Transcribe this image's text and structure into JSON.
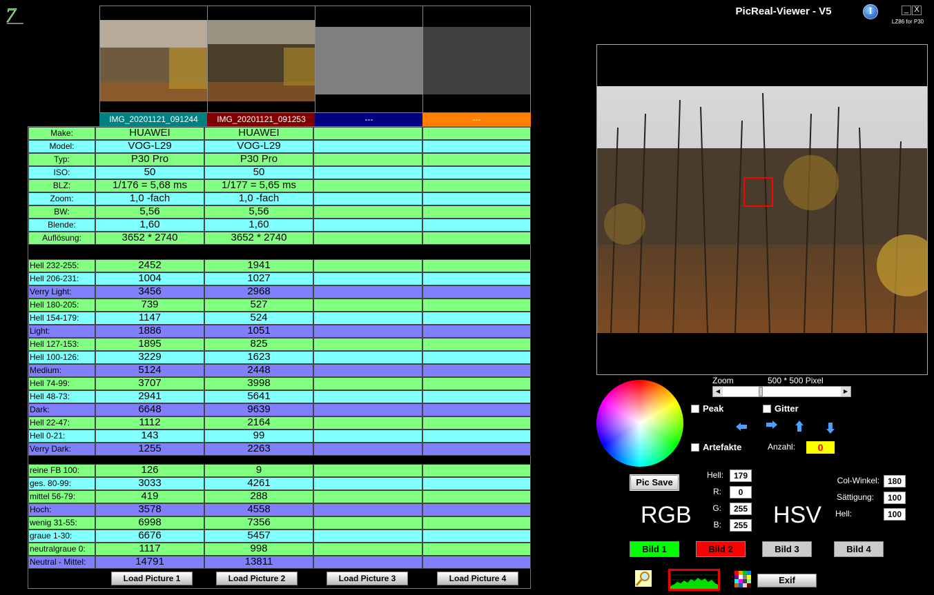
{
  "app": {
    "title": "PicReal-Viewer - V5",
    "subtitle": "LZ86 for P30",
    "min_label": "_",
    "close_label": "X",
    "info_label": "I"
  },
  "files": [
    {
      "name": "IMG_20201121_091244",
      "color": "#008080"
    },
    {
      "name": "IMG_20201121_091253",
      "color": "#800000"
    },
    {
      "name": "---",
      "color": "#000080"
    },
    {
      "name": "---",
      "color": "#ff8000"
    }
  ],
  "exif_rows": [
    {
      "label": "Make:",
      "values": [
        "HUAWEI",
        "HUAWEI",
        "",
        ""
      ],
      "color": "#80ff80"
    },
    {
      "label": "Model:",
      "values": [
        "VOG-L29",
        "VOG-L29",
        "",
        ""
      ],
      "color": "#80ffff"
    },
    {
      "label": "Typ:",
      "values": [
        "P30 Pro",
        "P30 Pro",
        "",
        ""
      ],
      "color": "#80ff80"
    },
    {
      "label": "ISO:",
      "values": [
        "50",
        "50",
        "",
        ""
      ],
      "color": "#80ffff"
    },
    {
      "label": "BLZ:",
      "values": [
        "1/176 = 5,68 ms",
        "1/177 = 5,65 ms",
        "",
        ""
      ],
      "color": "#80ff80"
    },
    {
      "label": "Zoom:",
      "values": [
        "1,0 -fach",
        "1,0 -fach",
        "",
        ""
      ],
      "color": "#80ffff"
    },
    {
      "label": "BW:",
      "values": [
        "5,56",
        "5,56",
        "",
        ""
      ],
      "color": "#80ff80"
    },
    {
      "label": "Blende:",
      "values": [
        "1,60",
        "1,60",
        "",
        ""
      ],
      "color": "#80ffff"
    },
    {
      "label": "Auflösung:",
      "values": [
        "3652 * 2740",
        "3652 * 2740",
        "",
        ""
      ],
      "color": "#80ff80"
    }
  ],
  "bright_rows": [
    {
      "label": "Hell 232-255:",
      "values": [
        "2452",
        "1941",
        "",
        ""
      ],
      "color": "#80ff80"
    },
    {
      "label": "Hell 206-231:",
      "values": [
        "1004",
        "1027",
        "",
        ""
      ],
      "color": "#80ffff"
    },
    {
      "label": "Verry Light:",
      "values": [
        "3456",
        "2968",
        "",
        ""
      ],
      "color": "#8080ff"
    },
    {
      "label": "Hell 180-205:",
      "values": [
        "739",
        "527",
        "",
        ""
      ],
      "color": "#80ff80"
    },
    {
      "label": "Hell 154-179:",
      "values": [
        "1147",
        "524",
        "",
        ""
      ],
      "color": "#80ffff"
    },
    {
      "label": "Light:",
      "values": [
        "1886",
        "1051",
        "",
        ""
      ],
      "color": "#8080ff"
    },
    {
      "label": "Hell 127-153:",
      "values": [
        "1895",
        "825",
        "",
        ""
      ],
      "color": "#80ff80"
    },
    {
      "label": "Hell 100-126:",
      "values": [
        "3229",
        "1623",
        "",
        ""
      ],
      "color": "#80ffff"
    },
    {
      "label": "Medium:",
      "values": [
        "5124",
        "2448",
        "",
        ""
      ],
      "color": "#8080ff"
    },
    {
      "label": "Hell 74-99:",
      "values": [
        "3707",
        "3998",
        "",
        ""
      ],
      "color": "#80ff80"
    },
    {
      "label": "Hell 48-73:",
      "values": [
        "2941",
        "5641",
        "",
        ""
      ],
      "color": "#80ffff"
    },
    {
      "label": "Dark:",
      "values": [
        "6648",
        "9639",
        "",
        ""
      ],
      "color": "#8080ff"
    },
    {
      "label": "Hell 22-47:",
      "values": [
        "1112",
        "2164",
        "",
        ""
      ],
      "color": "#80ff80"
    },
    {
      "label": "Hell 0-21:",
      "values": [
        "143",
        "99",
        "",
        ""
      ],
      "color": "#80ffff"
    },
    {
      "label": "Verry Dark:",
      "values": [
        "1255",
        "2263",
        "",
        ""
      ],
      "color": "#8080ff"
    }
  ],
  "color_rows": [
    {
      "label": "reine FB 100:",
      "values": [
        "126",
        "9",
        "",
        ""
      ],
      "color": "#80ff80"
    },
    {
      "label": "ges. 80-99:",
      "values": [
        "3033",
        "4261",
        "",
        ""
      ],
      "color": "#80ffff"
    },
    {
      "label": "mittel 56-79:",
      "values": [
        "419",
        "288",
        "",
        ""
      ],
      "color": "#80ff80"
    },
    {
      "label": "Hoch:",
      "values": [
        "3578",
        "4558",
        "",
        ""
      ],
      "color": "#8080ff"
    },
    {
      "label": "wenig 31-55:",
      "values": [
        "6998",
        "7356",
        "",
        ""
      ],
      "color": "#80ff80"
    },
    {
      "label": "graue  1-30:",
      "values": [
        "6676",
        "5457",
        "",
        ""
      ],
      "color": "#80ffff"
    },
    {
      "label": "neutralgraue 0:",
      "values": [
        "1117",
        "998",
        "",
        ""
      ],
      "color": "#80ff80"
    },
    {
      "label": "Neutral - Mittel:",
      "values": [
        "14791",
        "13811",
        "",
        ""
      ],
      "color": "#8080ff"
    }
  ],
  "load_buttons": [
    "Load Picture 1",
    "Load Picture 2",
    "Load Picture 3",
    "Load Picture 4"
  ],
  "zoom": {
    "label": "Zoom",
    "value": "500 * 500 Pixel"
  },
  "checks": {
    "peak": "Peak",
    "gitter": "Gitter",
    "artefakte": "Artefakte"
  },
  "anzahl": {
    "label": "Anzahl:",
    "value": "0"
  },
  "pic_save": "Pic Save",
  "rgb": {
    "title": "RGB",
    "hell_label": "Hell:",
    "hell": "179",
    "r_label": "R:",
    "r": "0",
    "g_label": "G:",
    "g": "255",
    "b_label": "B:",
    "b": "255"
  },
  "hsv": {
    "title": "HSV",
    "winkel_label": "Col-Winkel:",
    "winkel": "180",
    "saett_label": "Sättigung:",
    "saett": "100",
    "hell_label": "Hell:",
    "hell": "100"
  },
  "bild_buttons": [
    {
      "label": "Bild 1",
      "color": "#00ff00"
    },
    {
      "label": "Bild 2",
      "color": "#ff0000"
    },
    {
      "label": "Bild 3",
      "color": "#cccccc"
    },
    {
      "label": "Bild 4",
      "color": "#cccccc"
    }
  ],
  "exif_button": "Exif"
}
